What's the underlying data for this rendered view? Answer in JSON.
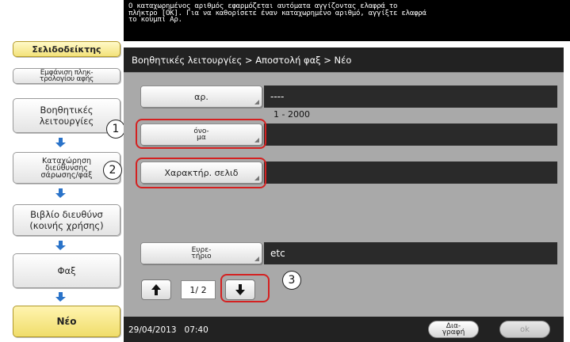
{
  "message": "Ο καταχωρημένος αριθμός εφαρμόζεται αυτόματα αγγίζοντας ελαφρά το\nπλήκτρο [OK]. Για να καθορίσετε έναν καταχωρημένο αριθμό, αγγίξτε ελαφρά\nτο κουμπί Αρ.",
  "sidebar": {
    "bookmark_tab": "Σελιδοδείκτης",
    "keypad_label": "Εμφάνιση πληκ-\nτρολογίου αφής",
    "steps": [
      "Βοηθητικές\nλειτουργίες",
      "Καταχώρηση\nδιεύθυνσης\nσάρωσης/φαξ",
      "Βιβλίο διευθύνσ\n(κοινής χρήσης)",
      "Φαξ",
      "Νέο"
    ]
  },
  "breadcrumb": "Βοηθητικές λειτουργίες > Αποστολή φαξ > Νέο",
  "fields": {
    "number": {
      "label": "αρ.",
      "value": "----"
    },
    "range": "1 - 2000",
    "name": {
      "label": "όνο-\nμα",
      "value": ""
    },
    "char": {
      "label": "Χαρακτήρ. σελιδ",
      "value": ""
    },
    "index": {
      "label": "Ευρε-\nτήριο",
      "value": "etc"
    }
  },
  "pager": {
    "indicator": "1/ 2"
  },
  "callouts": [
    "1",
    "2",
    "3"
  ],
  "status": {
    "datetime": "29/04/2013   07:40",
    "delete_label": "Δια-\nγραφή",
    "ok_label": "ok"
  },
  "colors": {
    "highlight": "#d42121",
    "arrow": "#2a73c9",
    "tab": "#f3e27a"
  }
}
